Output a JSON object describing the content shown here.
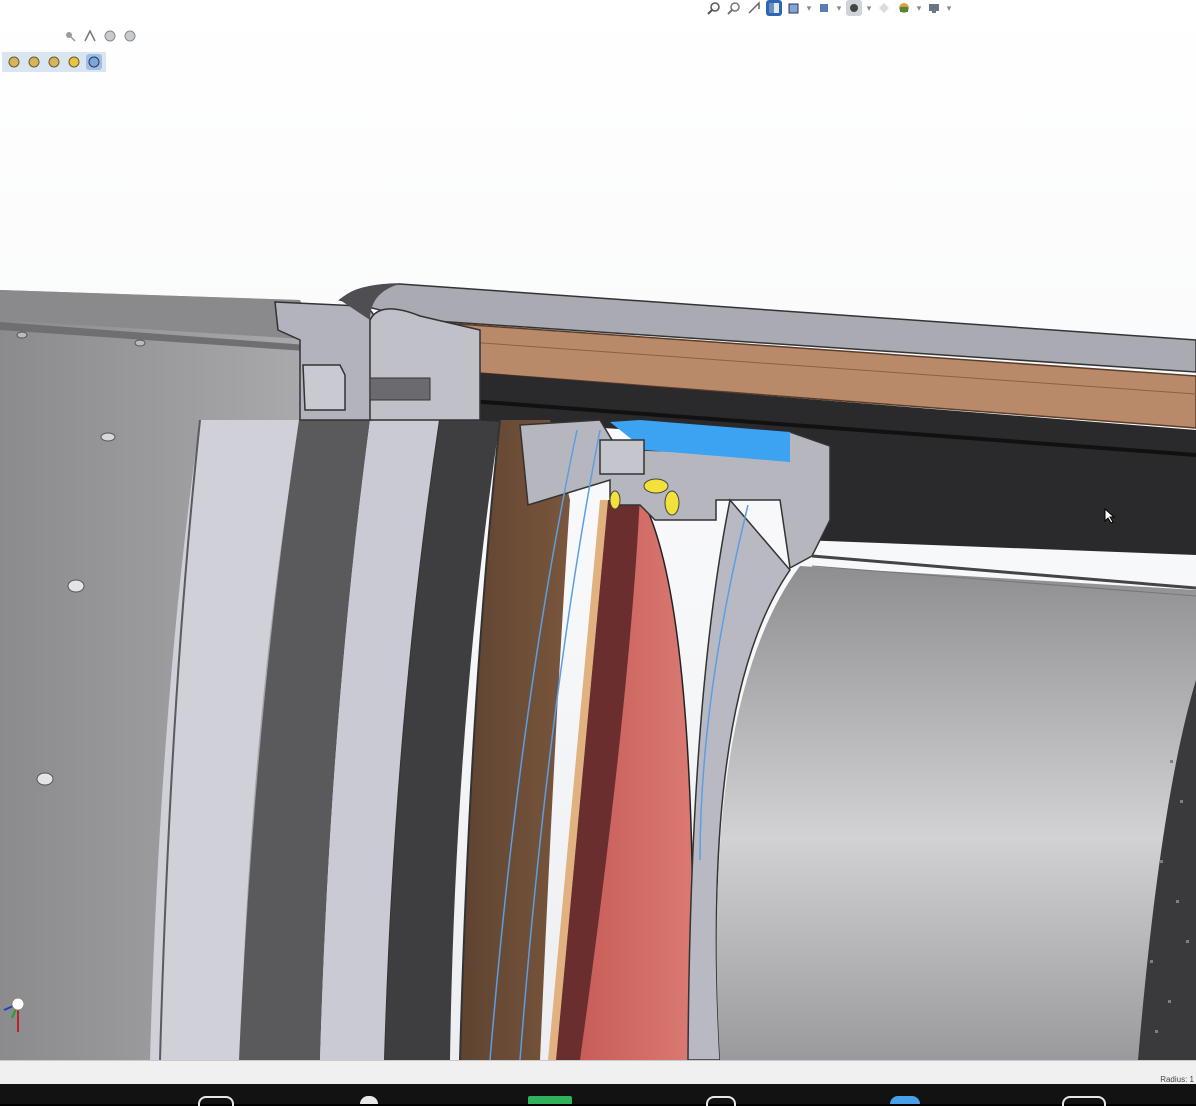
{
  "app": {
    "accent": "#1f5fbf"
  },
  "viewport": {
    "background": [
      "#ffffff",
      "#eceef1"
    ],
    "model_colors": {
      "housing": "#8f8f92",
      "section_cut": "#b4b6be",
      "brown_layer": "#b58768",
      "blue_face": "#3ba3f2",
      "red_part": "#c9625c",
      "yellow_parts": "#f2e13a"
    }
  },
  "hud_top": {
    "icons": [
      "zoom-to-fit-icon",
      "zoom-area-icon",
      "previous-view-icon",
      "section-view-icon",
      "view-orientation-icon",
      "display-style-icon",
      "hide-show-icon",
      "edit-appearance-icon",
      "apply-scene-icon",
      "view-settings-icon"
    ]
  },
  "hud_left": {
    "row1": [
      "pin-icon",
      "sketch-icon",
      "circle-icon",
      "circle-icon-2"
    ],
    "row2": [
      "part-icon-1",
      "part-icon-2",
      "part-icon-3",
      "part-icon-4",
      "part-icon-5"
    ]
  },
  "status_bar": {
    "text": "Radius: 1"
  },
  "taskbar": {
    "icons": [
      "taskbar-app-1",
      "taskbar-app-2",
      "taskbar-app-3",
      "taskbar-app-4",
      "taskbar-app-5",
      "taskbar-app-6"
    ]
  }
}
